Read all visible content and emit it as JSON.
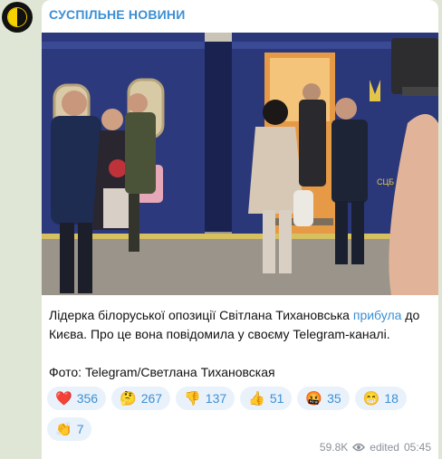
{
  "channel": {
    "name": "СУСПІЛЬНЕ НОВИНИ"
  },
  "message": {
    "text_before": "Лідерка білоруської опозиції Світлана Тихановська ",
    "link_text": "прибула",
    "text_after": " до Києва. Про це вона повідомила у своєму Telegram-каналі.",
    "photo_credit": "Фото: Telegram/Светлана Тихановская"
  },
  "reactions": [
    {
      "emoji": "❤️",
      "count": "356",
      "icon": "red-heart-icon"
    },
    {
      "emoji": "🤔",
      "count": "267",
      "icon": "thinking-face-icon"
    },
    {
      "emoji": "👎",
      "count": "137",
      "icon": "thumbs-down-icon"
    },
    {
      "emoji": "👍",
      "count": "51",
      "icon": "thumbs-up-icon"
    },
    {
      "emoji": "🤬",
      "count": "35",
      "icon": "cursing-face-icon"
    },
    {
      "emoji": "😁",
      "count": "18",
      "icon": "grinning-face-icon"
    },
    {
      "emoji": "👏",
      "count": "7",
      "icon": "clapping-hands-icon"
    }
  ],
  "meta": {
    "views": "59.8K",
    "edited": "edited",
    "time": "05:45"
  },
  "photo": {
    "train_emblem": "СЦБ"
  },
  "colors": {
    "accent": "#3b8fd4",
    "reaction_bg": "#e9f2fb",
    "chat_bg": "#dfe6d6",
    "train": "#2b3a7a"
  }
}
